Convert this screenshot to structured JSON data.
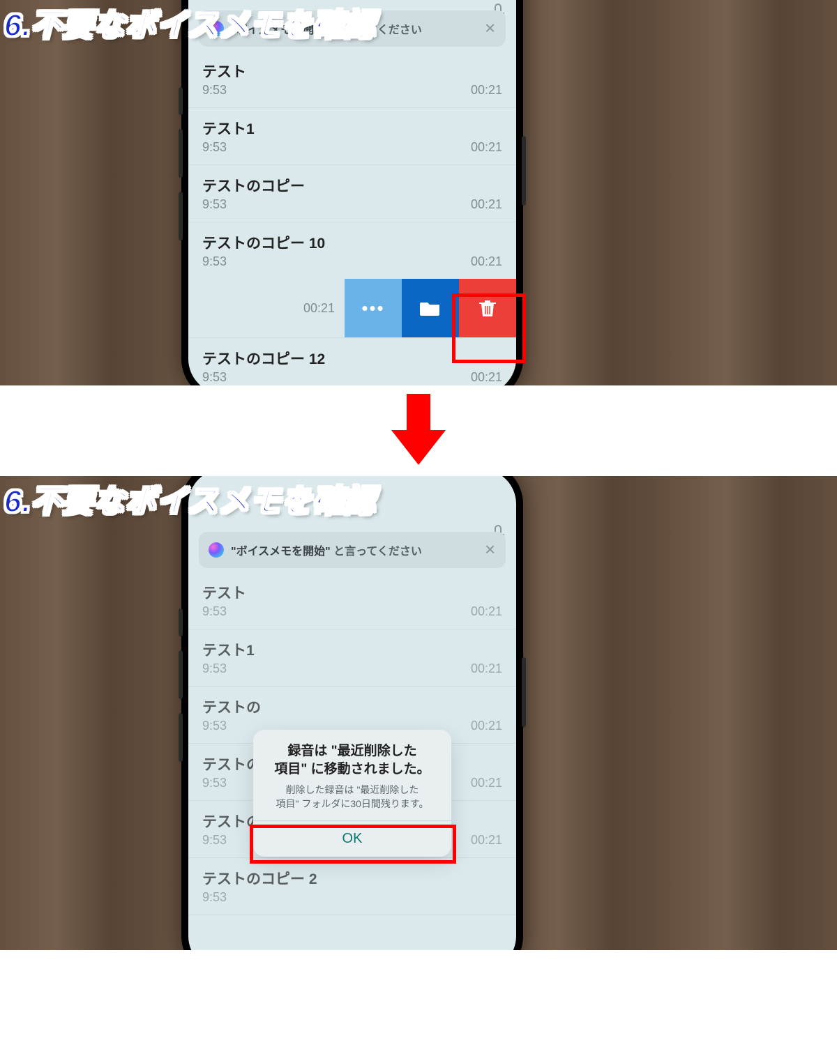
{
  "overlay_title": "6.不要なボイスメモを確認",
  "siri": {
    "quoted": "\"ボイスメモを開始\"",
    "suffix": " と言ってください"
  },
  "screen1": {
    "items": [
      {
        "title": "テスト",
        "time": "9:53",
        "dur": "00:21"
      },
      {
        "title": "テスト1",
        "time": "9:53",
        "dur": "00:21"
      },
      {
        "title": "テストのコピー",
        "time": "9:53",
        "dur": "00:21"
      },
      {
        "title": "テストのコピー 10",
        "time": "9:53",
        "dur": "00:21"
      }
    ],
    "swiped_dur": "00:21",
    "after_item": {
      "title": "テストのコピー 12",
      "time": "9:53",
      "dur": "00:21"
    }
  },
  "screen2": {
    "items": [
      {
        "title": "テスト",
        "time": "9:53",
        "dur": "00:21"
      },
      {
        "title": "テスト1",
        "time": "9:53",
        "dur": "00:21"
      },
      {
        "title": "テストの",
        "time": "9:53",
        "dur": "00:21"
      },
      {
        "title": "テストの",
        "time": "9:53",
        "dur": "00:21"
      },
      {
        "title": "テストのコピー 12",
        "time": "9:53",
        "dur": "00:21"
      },
      {
        "title": "テストのコピー 2",
        "time": "9:53",
        "dur": ""
      }
    ],
    "dialog": {
      "title_l1": "録音は \"最近削除した",
      "title_l2": "項目\" に移動されました。",
      "sub_l1": "削除した録音は \"最近削除した",
      "sub_l2": "項目\" フォルダに30日間残ります。",
      "ok": "OK"
    }
  }
}
